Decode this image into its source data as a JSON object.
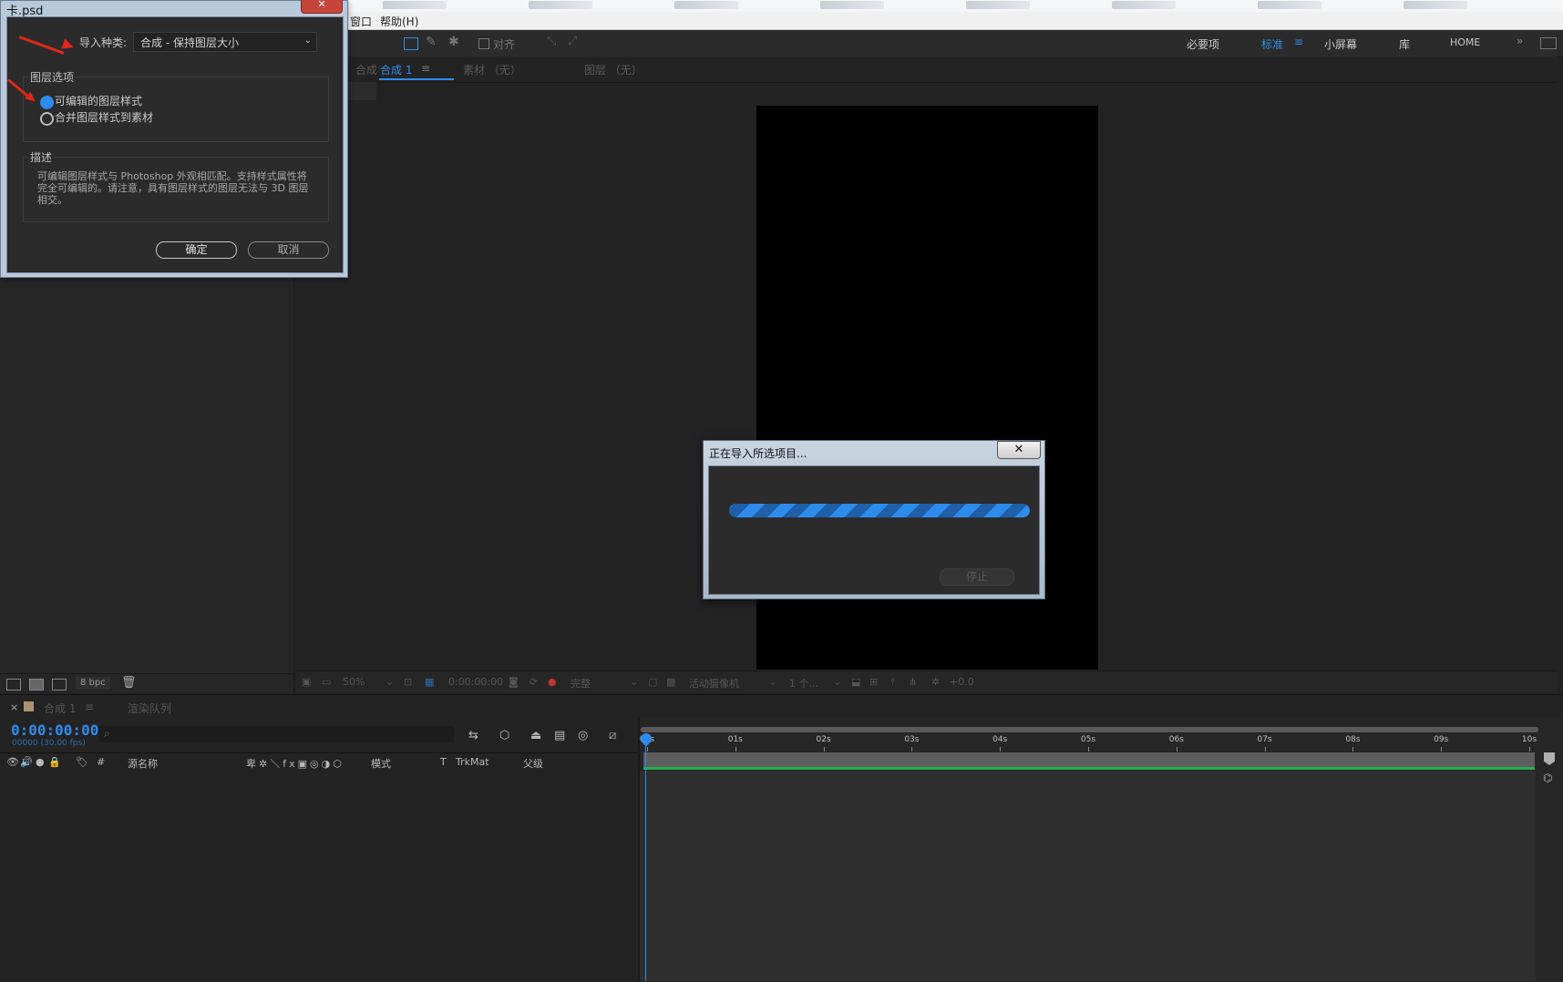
{
  "menu": {
    "items": [
      "窗口",
      "帮助(H)"
    ]
  },
  "toolbar": {
    "snap_label": "对齐"
  },
  "workspaces": [
    {
      "label": "必要项",
      "active": false
    },
    {
      "label": "标准",
      "active": true
    },
    {
      "label": "小屏幕",
      "active": false
    },
    {
      "label": "库",
      "active": false
    },
    {
      "label": "HOME",
      "active": false
    }
  ],
  "viewer": {
    "comp_tab_prefix": "合成",
    "comp_tab_name": "合成 1",
    "footage_tab": "素材 （无）",
    "layer_tab": "图层 （无）",
    "zoom": "50%",
    "timecode": "0:00:00:00",
    "resolution": "完整",
    "camera": "活动摄像机",
    "views": "1 个...",
    "exposure": "+0.0"
  },
  "project": {
    "bpc": "8 bpc"
  },
  "timeline": {
    "tab_name": "合成 1",
    "render_queue": "渲染队列",
    "timecode": "0:00:00:00",
    "fps": "00000 (30.00 fps)",
    "columns": {
      "num": "#",
      "source": "源名称",
      "mode": "模式",
      "t": "T",
      "trkmat": "TrkMat",
      "parent": "父级"
    },
    "ruler": [
      "00s",
      "01s",
      "02s",
      "03s",
      "04s",
      "05s",
      "06s",
      "07s",
      "08s",
      "09s",
      "10s"
    ]
  },
  "import_dialog": {
    "title": "卡.psd",
    "import_kind_label": "导入种类:",
    "import_kind_value": "合成 - 保持图层大小",
    "layer_options_title": "图层选项",
    "option_editable": "可编辑的图层样式",
    "option_merge": "合并图层样式到素材",
    "selected_option": "editable",
    "description_title": "描述",
    "description": "可编辑图层样式与 Photoshop 外观相匹配。支持样式属性将完全可编辑的。请注意，具有图层样式的图层无法与 3D 图层相交。",
    "ok": "确定",
    "cancel": "取消"
  },
  "progress_dialog": {
    "title": "正在导入所选项目...",
    "close": "✕",
    "stop": "停止",
    "accent": "#2d8ceb"
  }
}
